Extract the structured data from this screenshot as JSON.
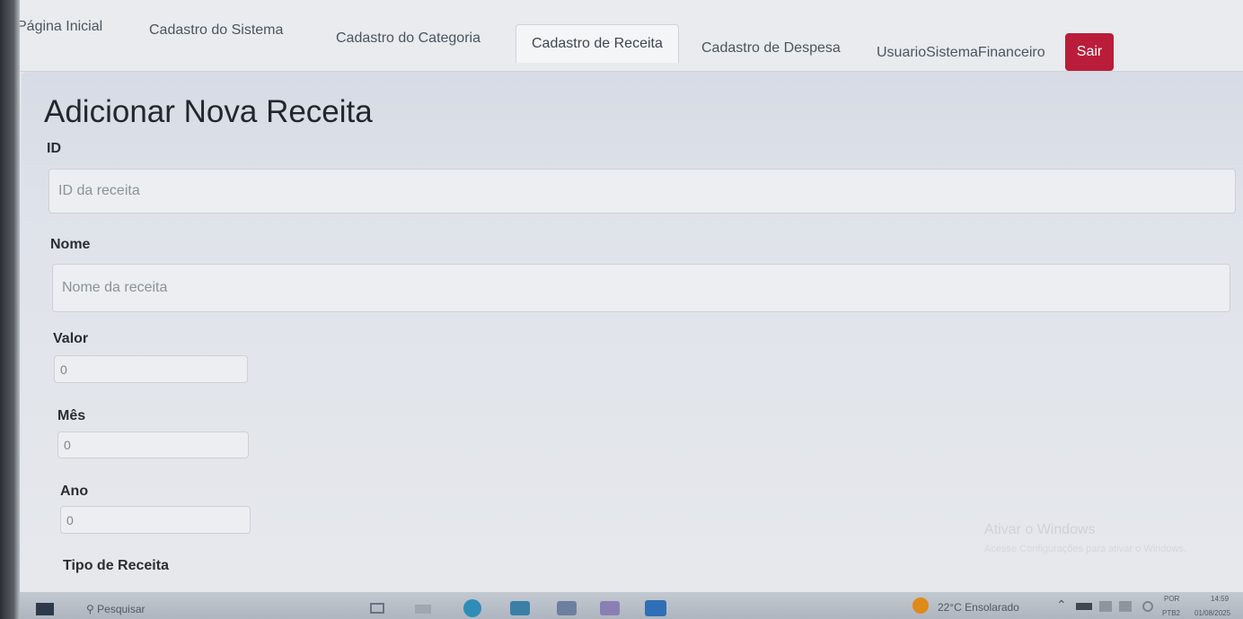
{
  "nav": {
    "items": [
      {
        "label": "Página Inicial"
      },
      {
        "label": "Cadastro do Sistema"
      },
      {
        "label": "Cadastro do Categoria"
      },
      {
        "label": "Cadastro de Receita"
      },
      {
        "label": "Cadastro de Despesa"
      },
      {
        "label": "UsuarioSistemaFinanceiro"
      }
    ],
    "active": "Cadastro de Receita",
    "logout_label": "Sair"
  },
  "form": {
    "title": "Adicionar Nova Receita",
    "fields": {
      "id": {
        "label": "ID",
        "placeholder": "ID da receita"
      },
      "nome": {
        "label": "Nome",
        "placeholder": "Nome da receita"
      },
      "valor": {
        "label": "Valor",
        "value": "0"
      },
      "mes": {
        "label": "Mês",
        "value": "0"
      },
      "ano": {
        "label": "Ano",
        "value": "0"
      },
      "tipo": {
        "label": "Tipo de Receita"
      }
    }
  },
  "taskbar": {
    "search_placeholder": "Pesquisar",
    "weather": "22°C  Ensolarado",
    "lang": "POR",
    "lang2": "PTB2",
    "time": "14:59",
    "date": "01/08/2025"
  },
  "watermark": {
    "title": "Ativar o Windows",
    "subtitle": "Acesse Configurações para ativar o Windows."
  },
  "colors": {
    "logout_button": "#b91d3a",
    "background": "#dfe3ea"
  }
}
